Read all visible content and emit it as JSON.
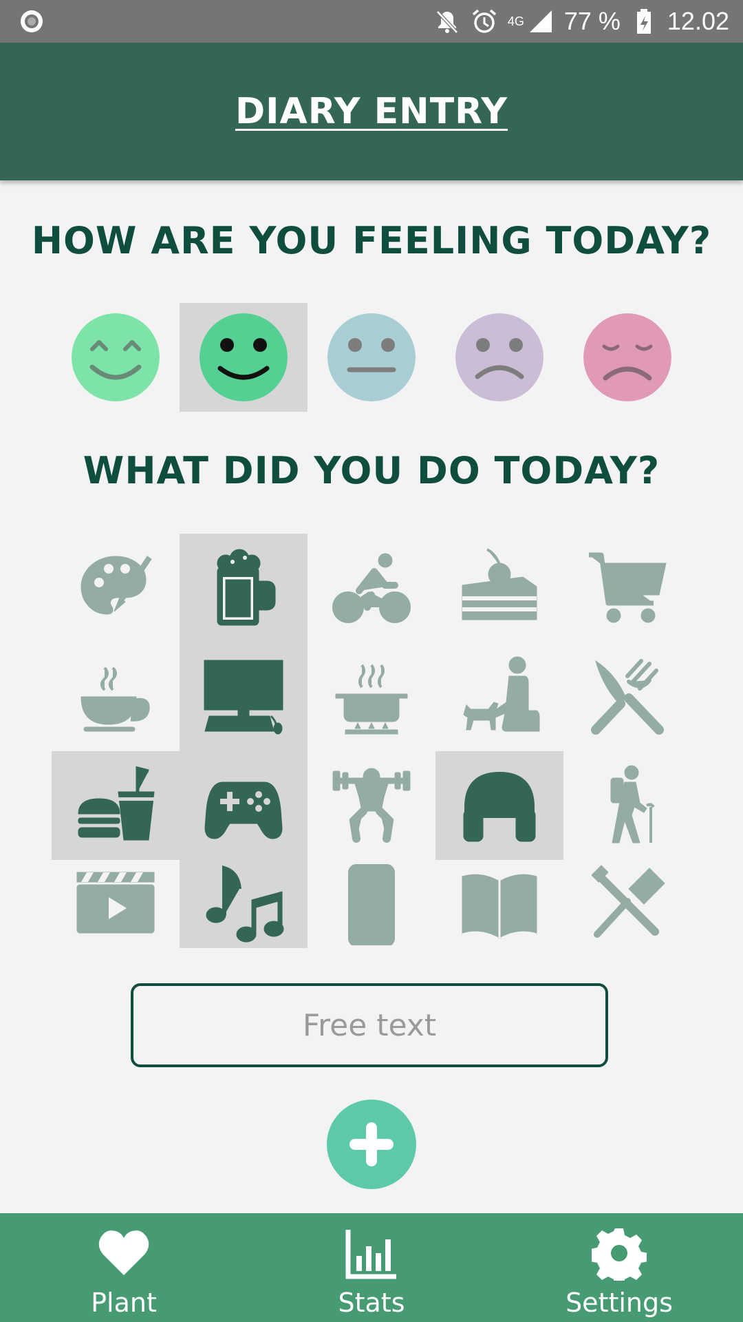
{
  "status_bar": {
    "battery": "77 %",
    "time": "12.02",
    "network": "4G",
    "icons": [
      "record-icon",
      "bell-off-icon",
      "alarm-icon",
      "signal-icon",
      "battery-charging-icon"
    ]
  },
  "header": {
    "title": "DIARY ENTRY"
  },
  "mood_section": {
    "title": "HOW ARE YOU FEELING TODAY?",
    "moods": [
      {
        "name": "very-happy",
        "color": "#7de3a8",
        "selected": false
      },
      {
        "name": "happy",
        "color": "#54d192",
        "selected": true
      },
      {
        "name": "neutral",
        "color": "#a8cdd3",
        "selected": false
      },
      {
        "name": "sad",
        "color": "#ccbdd6",
        "selected": false
      },
      {
        "name": "very-sad",
        "color": "#e09ab8",
        "selected": false
      }
    ]
  },
  "activity_section": {
    "title": "WHAT DID YOU DO TODAY?",
    "activities": [
      {
        "icon": "palette-icon",
        "selected": false
      },
      {
        "icon": "beer-icon",
        "selected": true
      },
      {
        "icon": "cycling-icon",
        "selected": false
      },
      {
        "icon": "cake-icon",
        "selected": false
      },
      {
        "icon": "shopping-cart-icon",
        "selected": false
      },
      {
        "icon": "coffee-icon",
        "selected": false
      },
      {
        "icon": "computer-icon",
        "selected": true
      },
      {
        "icon": "cooking-icon",
        "selected": false
      },
      {
        "icon": "dog-walk-icon",
        "selected": false
      },
      {
        "icon": "eating-out-icon",
        "selected": false
      },
      {
        "icon": "fast-food-icon",
        "selected": true
      },
      {
        "icon": "gamepad-icon",
        "selected": true
      },
      {
        "icon": "weightlifting-icon",
        "selected": false
      },
      {
        "icon": "headphones-icon",
        "selected": true
      },
      {
        "icon": "hiking-icon",
        "selected": false
      },
      {
        "icon": "movie-icon",
        "selected": false
      },
      {
        "icon": "music-icon",
        "selected": true
      },
      {
        "icon": "phone-icon",
        "selected": false
      },
      {
        "icon": "book-icon",
        "selected": false
      },
      {
        "icon": "tools-icon",
        "selected": false
      }
    ]
  },
  "free_text": {
    "placeholder": "Free text",
    "value": ""
  },
  "add_button": {
    "icon": "plus-icon"
  },
  "bottom_nav": {
    "items": [
      {
        "label": "Plant",
        "icon": "heart-icon"
      },
      {
        "label": "Stats",
        "icon": "bar-chart-icon"
      },
      {
        "label": "Settings",
        "icon": "gear-icon"
      }
    ]
  },
  "colors": {
    "primary_dark": "#336655",
    "title_text": "#0f4d3f",
    "nav_bar": "#479b73",
    "fab": "#5ccaa9",
    "icon_unselected": "#94aca1",
    "selection_bg": "#d6d6d6"
  }
}
